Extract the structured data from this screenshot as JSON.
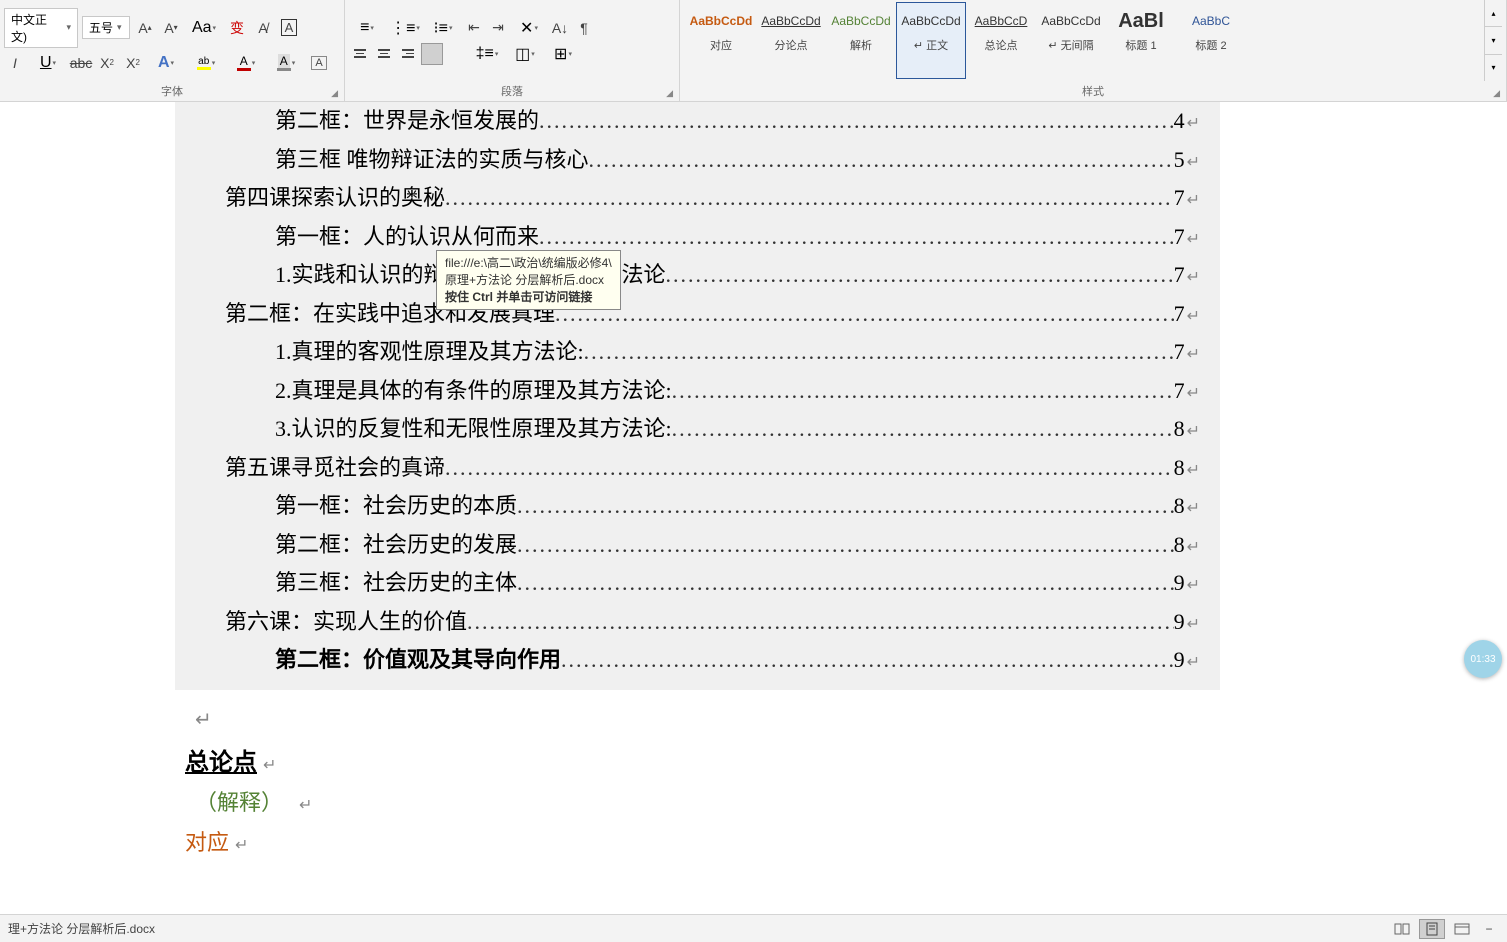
{
  "ribbon": {
    "font": {
      "family": "中文正文)",
      "size": "五号",
      "group_label": "字体"
    },
    "paragraph": {
      "group_label": "段落"
    },
    "styles": {
      "group_label": "样式",
      "items": [
        {
          "preview": "AaBbCcDd",
          "label": "对应",
          "cls": "orange"
        },
        {
          "preview": "AaBbCcDd",
          "label": "分论点",
          "cls": "underline"
        },
        {
          "preview": "AaBbCcDd",
          "label": "解析",
          "cls": "green"
        },
        {
          "preview": "AaBbCcDd",
          "label": "↵ 正文",
          "cls": ""
        },
        {
          "preview": "AaBbCcD",
          "label": "总论点",
          "cls": "underline bold"
        },
        {
          "preview": "AaBbCcDd",
          "label": "↵ 无间隔",
          "cls": ""
        },
        {
          "preview": "AaBl",
          "label": "标题 1",
          "cls": "big"
        },
        {
          "preview": "AaBbC",
          "label": "标题 2",
          "cls": "blue"
        }
      ]
    }
  },
  "tooltip": {
    "line1": "file:///e:\\高二\\政治\\统编版必修4\\",
    "line2": "原理+方法论 分层解析后.docx",
    "line3": "按住 Ctrl 并单击可访问链接"
  },
  "toc": [
    {
      "indent": 1,
      "text": "第二框：世界是永恒发展的",
      "page": "4",
      "bold": false
    },
    {
      "indent": 1,
      "text": "第三框 唯物辩证法的实质与核心",
      "page": "5",
      "bold": false
    },
    {
      "indent": 0,
      "text": "第四课探索认识的奥秘",
      "page": "7",
      "bold": false
    },
    {
      "indent": 1,
      "text": "第一框：人的认识从何而来",
      "page": "7",
      "bold": false
    },
    {
      "indent": 2,
      "text": "1.实践和认识的辩证关系原理及其方法论",
      "page": "7",
      "bold": false
    },
    {
      "indent": 0,
      "text": "第二框：在实践中追求和发展真理",
      "page": "7",
      "bold": false
    },
    {
      "indent": 2,
      "text": "1.真理的客观性原理及其方法论:",
      "page": "7",
      "bold": false
    },
    {
      "indent": 2,
      "text": "2.真理是具体的有条件的原理及其方法论:",
      "page": "7",
      "bold": false
    },
    {
      "indent": 2,
      "text": "3.认识的反复性和无限性原理及其方法论:",
      "page": "8",
      "bold": false
    },
    {
      "indent": 0,
      "text": "第五课寻觅社会的真谛",
      "page": "8",
      "bold": false
    },
    {
      "indent": 1,
      "text": "第一框：社会历史的本质",
      "page": "8",
      "bold": false
    },
    {
      "indent": 1,
      "text": "第二框：社会历史的发展",
      "page": "8",
      "bold": false
    },
    {
      "indent": 1,
      "text": "第三框：社会历史的主体",
      "page": "9",
      "bold": false
    },
    {
      "indent": 0,
      "text": "第六课：实现人生的价值",
      "page": "9",
      "bold": false
    },
    {
      "indent": 1,
      "text": "第二框：价值观及其导向作用",
      "page": "9",
      "bold": true
    }
  ],
  "body_after": {
    "zonglundian": "总论点",
    "jieshi": "（解释）",
    "duiying": "对应"
  },
  "status": {
    "filename": "理+方法论 分层解析后.docx"
  },
  "badge": "01:33"
}
